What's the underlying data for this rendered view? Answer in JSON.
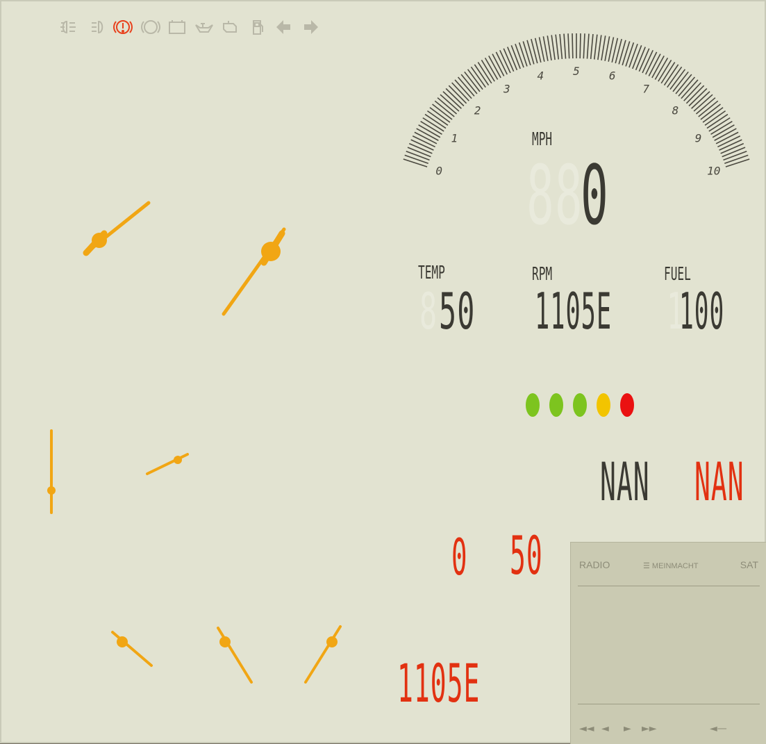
{
  "indicators": [
    {
      "name": "headlight-icon",
      "color": "#b9b8a8"
    },
    {
      "name": "fog-light-icon",
      "color": "#b9b8a8"
    },
    {
      "name": "brake-warning-icon",
      "color": "#e8401c"
    },
    {
      "name": "abs-icon",
      "color": "#b9b8a8"
    },
    {
      "name": "battery-icon",
      "color": "#b9b8a8"
    },
    {
      "name": "oil-icon",
      "color": "#b9b8a8"
    },
    {
      "name": "engine-icon",
      "color": "#b9b8a8"
    },
    {
      "name": "fuel-pump-icon",
      "color": "#b9b8a8"
    },
    {
      "name": "turn-left-icon",
      "color": "#b9b8a8"
    },
    {
      "name": "turn-right-icon",
      "color": "#b9b8a8"
    }
  ],
  "speedo": {
    "ticks": [
      "0",
      "1",
      "2",
      "3",
      "4",
      "5",
      "6",
      "7",
      "8",
      "9",
      "10"
    ],
    "unit": "MPH",
    "ghost": "88",
    "value": "0"
  },
  "temp": {
    "label": "TEMP",
    "ghost": "8",
    "value": "50"
  },
  "rpm": {
    "label": "RPM",
    "value": "1105E"
  },
  "fuel": {
    "label": "FUEL",
    "ghost": "1",
    "value": "100"
  },
  "leds": [
    "#7dc41f",
    "#7dc41f",
    "#7dc41f",
    "#f2c400",
    "#ea1111"
  ],
  "nan_black": "NAN",
  "nan_red": "NAN",
  "red_values": {
    "a": "0",
    "b": "50",
    "c": "1105E"
  },
  "radio": {
    "left_tab": "RADIO",
    "brand": "MEINMACHT",
    "right_tab": "SAT",
    "controls": {
      "rewind": "◄◄",
      "prev": "◄",
      "play": "►",
      "forward": "►►",
      "volume": "◄—"
    }
  },
  "colors": {
    "needle": "#f1a614",
    "digits": "#3b3a33",
    "red_digits": "#e23111",
    "gauge": "#4a483f"
  }
}
